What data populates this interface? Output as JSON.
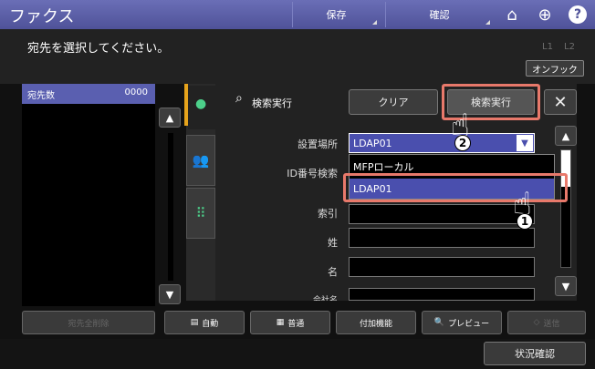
{
  "header": {
    "title": "ファクス",
    "save_label": "保存",
    "confirm_label": "確認",
    "home_icon": "home-icon",
    "globe_icon": "globe-icon",
    "help_icon": "help-icon"
  },
  "instruction": "宛先を選択してください。",
  "line_indicators": [
    "L1",
    "L2"
  ],
  "hook_label": "オンフック",
  "address_list": {
    "header_label": "宛先数",
    "count": "0000",
    "delete_all_label": "宛先全削除"
  },
  "search": {
    "icon": "search-icon",
    "label": "検索実行",
    "clear_label": "クリア",
    "execute_label": "検索実行"
  },
  "form": {
    "location_label": "設置場所",
    "location_value": "LDAP01",
    "dropdown_options": [
      "MFPローカル",
      "LDAP01"
    ],
    "id_label": "ID番号検索",
    "index_label": "索引",
    "last_name_label": "姓",
    "first_name_label": "名",
    "partial_label": "会社名"
  },
  "bottom_toolbar": {
    "auto_label": "自動",
    "normal_label": "普通",
    "extra_label": "付加機能",
    "preview_label": "プレビュー",
    "send_label": "送信"
  },
  "status_label": "状況確認",
  "step_badges": [
    "1",
    "2"
  ],
  "highlight_color": "#e8796b",
  "accent_color": "#5a5fb0"
}
